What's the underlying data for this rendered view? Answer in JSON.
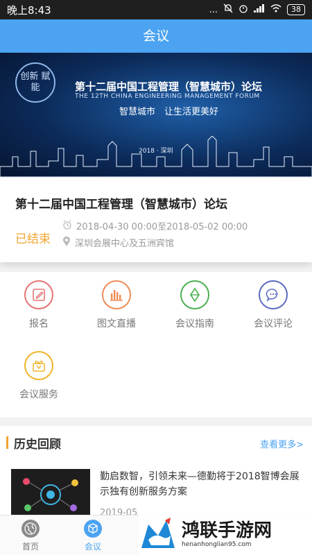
{
  "status_bar": {
    "time": "晚上8:43",
    "icons": "...",
    "battery": "38"
  },
  "header": {
    "title": "会议"
  },
  "banner": {
    "logo_text": "创新 赋能",
    "title_cn": "第十二届中国工程管理（智慧城市）论坛",
    "title_en": "THE 12TH CHINA ENGINEERING MANAGEMENT FORUM",
    "slogan": "智慧城市　让生活更美好",
    "year_place": "2018 · 深圳"
  },
  "conference": {
    "title": "第十二届中国工程管理（智慧城市）论坛",
    "status": "已结束",
    "time": "2018-04-30 00:00至2018-05-02 00:00",
    "location": "深圳会展中心及五洲宾馆"
  },
  "functions": [
    {
      "label": "报名",
      "icon": "edit-icon",
      "color": "#e57373"
    },
    {
      "label": "图文直播",
      "icon": "bars-icon",
      "color": "#ef8a56"
    },
    {
      "label": "会议指南",
      "icon": "compass-icon",
      "color": "#4caf50"
    },
    {
      "label": "会议评论",
      "icon": "chat-icon",
      "color": "#5c6bc0"
    },
    {
      "label": "会议服务",
      "icon": "gift-icon",
      "color": "#f0b429"
    }
  ],
  "history": {
    "title": "历史回顾",
    "more": "查看更多>",
    "items": [
      {
        "title": "勤启数智，引领未来—德勤将于2018智博会展示独有创新服务方案",
        "date": "2019-05"
      }
    ]
  },
  "tabs": [
    {
      "label": "首页",
      "icon": "globe-icon"
    },
    {
      "label": "会议",
      "icon": "cube-icon"
    }
  ],
  "watermark": {
    "text": "鸿联手游网",
    "url": "henanhonglian95.com"
  },
  "colors": {
    "primary": "#4ba3f1",
    "accent": "#f0a430"
  }
}
